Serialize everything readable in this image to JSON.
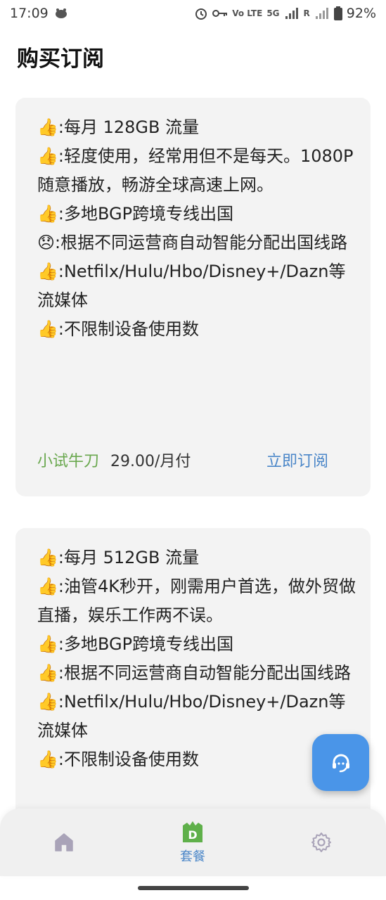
{
  "status_bar": {
    "time": "17:09",
    "battery": "92%",
    "network": "5G",
    "volte": "Vo LTE",
    "roaming": "R"
  },
  "page": {
    "title": "购买订阅"
  },
  "plans": [
    {
      "features": [
        {
          "icon": "👍",
          "text": ":每月 128GB 流量"
        },
        {
          "icon": "👍",
          "text": ":轻度使用，经常用但不是每天。1080P随意播放，畅游全球高速上网。"
        },
        {
          "icon": "👍",
          "text": ":多地BGP跨境专线出国"
        },
        {
          "icon": "😞",
          "text": ":根据不同运营商自动智能分配出国线路"
        },
        {
          "icon": "👍",
          "text": ":Netfilx/Hulu/Hbo/Disney+/Dazn等流媒体"
        },
        {
          "icon": "👍",
          "text": ":不限制设备使用数"
        }
      ],
      "name": "小试牛刀",
      "price": "29.00/月付",
      "subscribe_label": "立即订阅"
    },
    {
      "features": [
        {
          "icon": "👍",
          "text": ":每月 512GB 流量"
        },
        {
          "icon": "👍",
          "text": ":油管4K秒开，刚需用户首选，做外贸做直播，娱乐工作两不误。"
        },
        {
          "icon": "👍",
          "text": ":多地BGP跨境专线出国"
        },
        {
          "icon": "👍",
          "text": ":根据不同运营商自动智能分配出国线路"
        },
        {
          "icon": "👍",
          "text": ":Netfilx/Hulu/Hbo/Disney+/Dazn等流媒体"
        },
        {
          "icon": "👍",
          "text": ":不限制设备使用数"
        }
      ]
    }
  ],
  "bottom_nav": {
    "items": [
      {
        "icon": "home-icon",
        "label": ""
      },
      {
        "icon": "package-icon",
        "label": "套餐",
        "active": true
      },
      {
        "icon": "gear-icon",
        "label": ""
      }
    ],
    "active_color": "#4a86c8"
  },
  "fab": {
    "icon": "support-agent-icon",
    "color": "#4a95e8"
  },
  "colors": {
    "accent": "#4a86c8",
    "plan_name": "#6aa84f",
    "card_bg": "#f3f3f3"
  }
}
